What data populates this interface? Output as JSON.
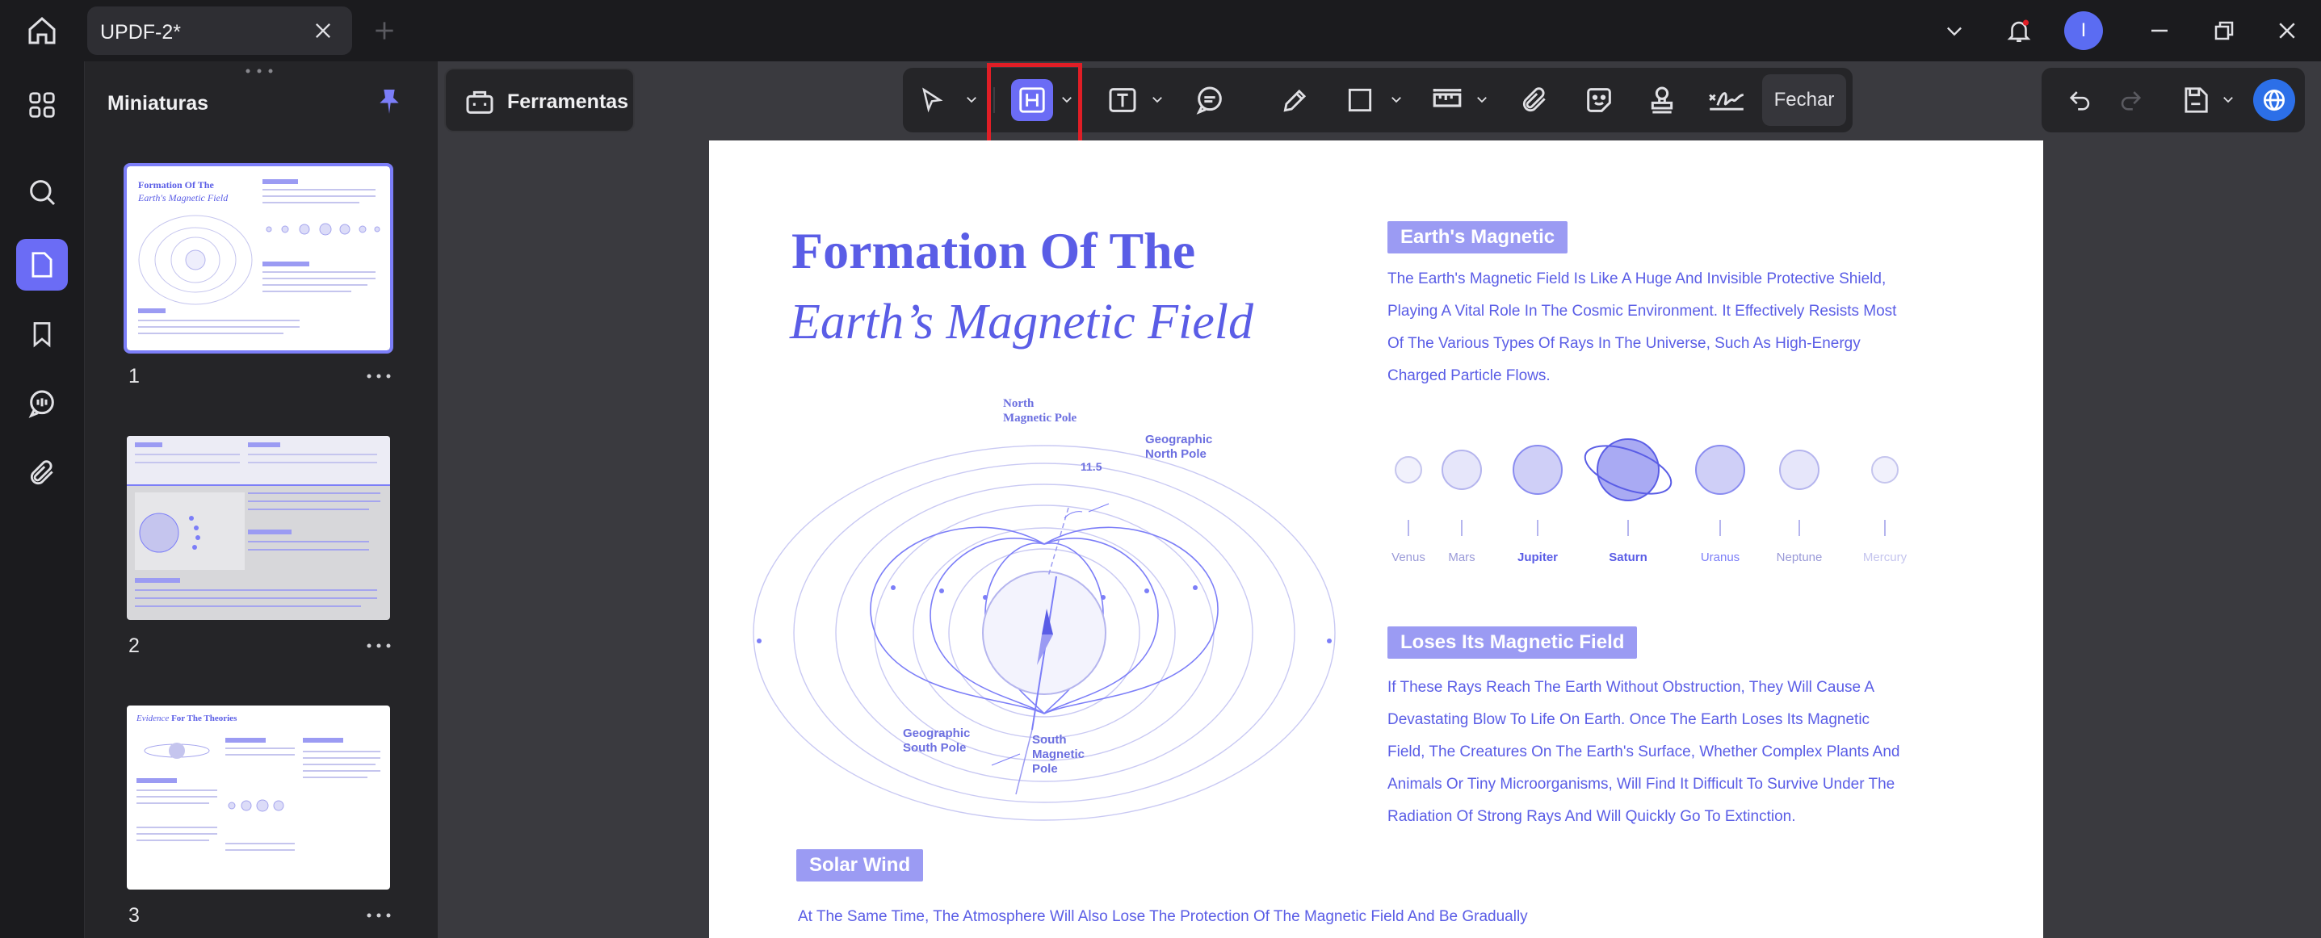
{
  "titlebar": {
    "tab_title": "UPDF-2*",
    "user_initial": "I"
  },
  "thumbnails": {
    "panel_title": "Miniaturas",
    "pages": [
      {
        "number": "1",
        "heading": "Formation Of The",
        "subheading": "Earth's Magnetic Field"
      },
      {
        "number": "2"
      },
      {
        "number": "3",
        "heading_italic": "Evidence",
        "heading_rest": "For The Theories"
      }
    ]
  },
  "toolbar": {
    "tools_label": "Ferramentas",
    "close_label": "Fechar",
    "accent": "#6b6cf5",
    "highlight_box_color": "#e01e26"
  },
  "document": {
    "title_line1": "Formation Of The",
    "title_line2": "Earth’s Magnetic Field",
    "section1": {
      "label": "Earth's Magnetic",
      "lines": [
        "The Earth's Magnetic Field Is Like A Huge And Invisible Protective Shield,",
        "Playing A Vital Role In The Cosmic Environment. It Effectively Resists Most",
        "Of The Various Types Of Rays In The Universe, Such As High-Energy",
        "Charged Particle Flows."
      ]
    },
    "planets": [
      "Venus",
      "Mars",
      "Jupiter",
      "Saturn",
      "Uranus",
      "Neptune",
      "Mercury"
    ],
    "section2": {
      "label": "Loses Its Magnetic Field",
      "lines": [
        "If These Rays Reach The Earth Without Obstruction, They Will Cause A",
        "Devastating Blow To Life On Earth. Once The Earth Loses Its Magnetic",
        "Field, The Creatures On The Earth's Surface, Whether Complex Plants And",
        "Animals Or Tiny Microorganisms, Will Find It Difficult To Survive Under The",
        "Radiation Of Strong Rays And Will Quickly Go To Extinction."
      ]
    },
    "section3": {
      "label": "Solar Wind",
      "line": "At The Same Time, The Atmosphere Will Also Lose The Protection Of The Magnetic Field And Be Gradually"
    },
    "diagram": {
      "north_magnetic_1": "North",
      "north_magnetic_2": "Magnetic Pole",
      "geo_north_1": "Geographic",
      "geo_north_2": "North Pole",
      "angle": "11.5",
      "geo_south_1": "Geographic",
      "geo_south_2": "South Pole",
      "south_mag_1": "South",
      "south_mag_2": "Magnetic",
      "south_mag_3": "Pole"
    }
  }
}
